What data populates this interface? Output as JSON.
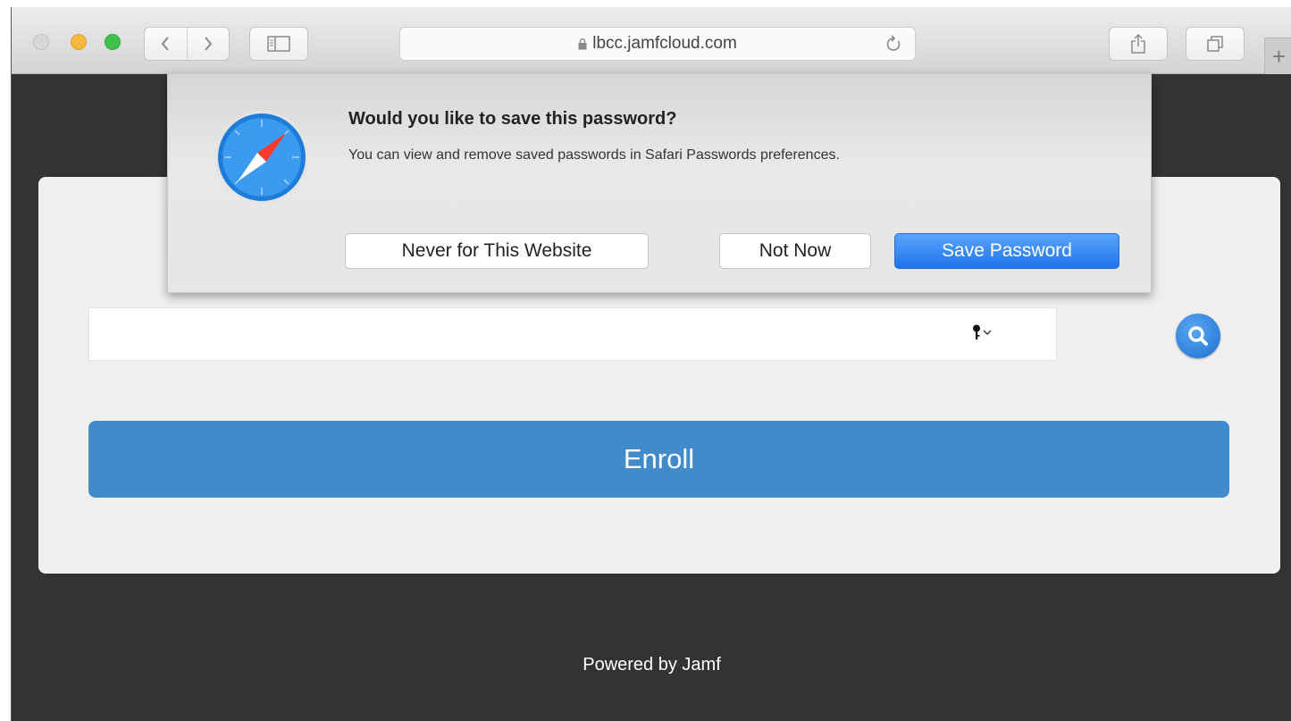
{
  "browser": {
    "address_url": "lbcc.jamfcloud.com"
  },
  "dialog": {
    "title": "Would you like to save this password?",
    "message": "You can view and remove saved passwords in Safari Passwords preferences.",
    "never_label": "Never for This Website",
    "not_now_label": "Not Now",
    "save_label": "Save Password"
  },
  "page": {
    "enroll_label": "Enroll",
    "footer": "Powered by Jamf"
  },
  "colors": {
    "enroll_button": "#428bca",
    "save_button": "#1d74ea",
    "page_background": "#333333"
  },
  "icons": [
    "safari-icon",
    "lock-icon",
    "reload-icon",
    "back-icon",
    "forward-icon",
    "sidebar-icon",
    "share-icon",
    "tabs-icon",
    "key-icon",
    "search-icon",
    "plus-icon"
  ]
}
